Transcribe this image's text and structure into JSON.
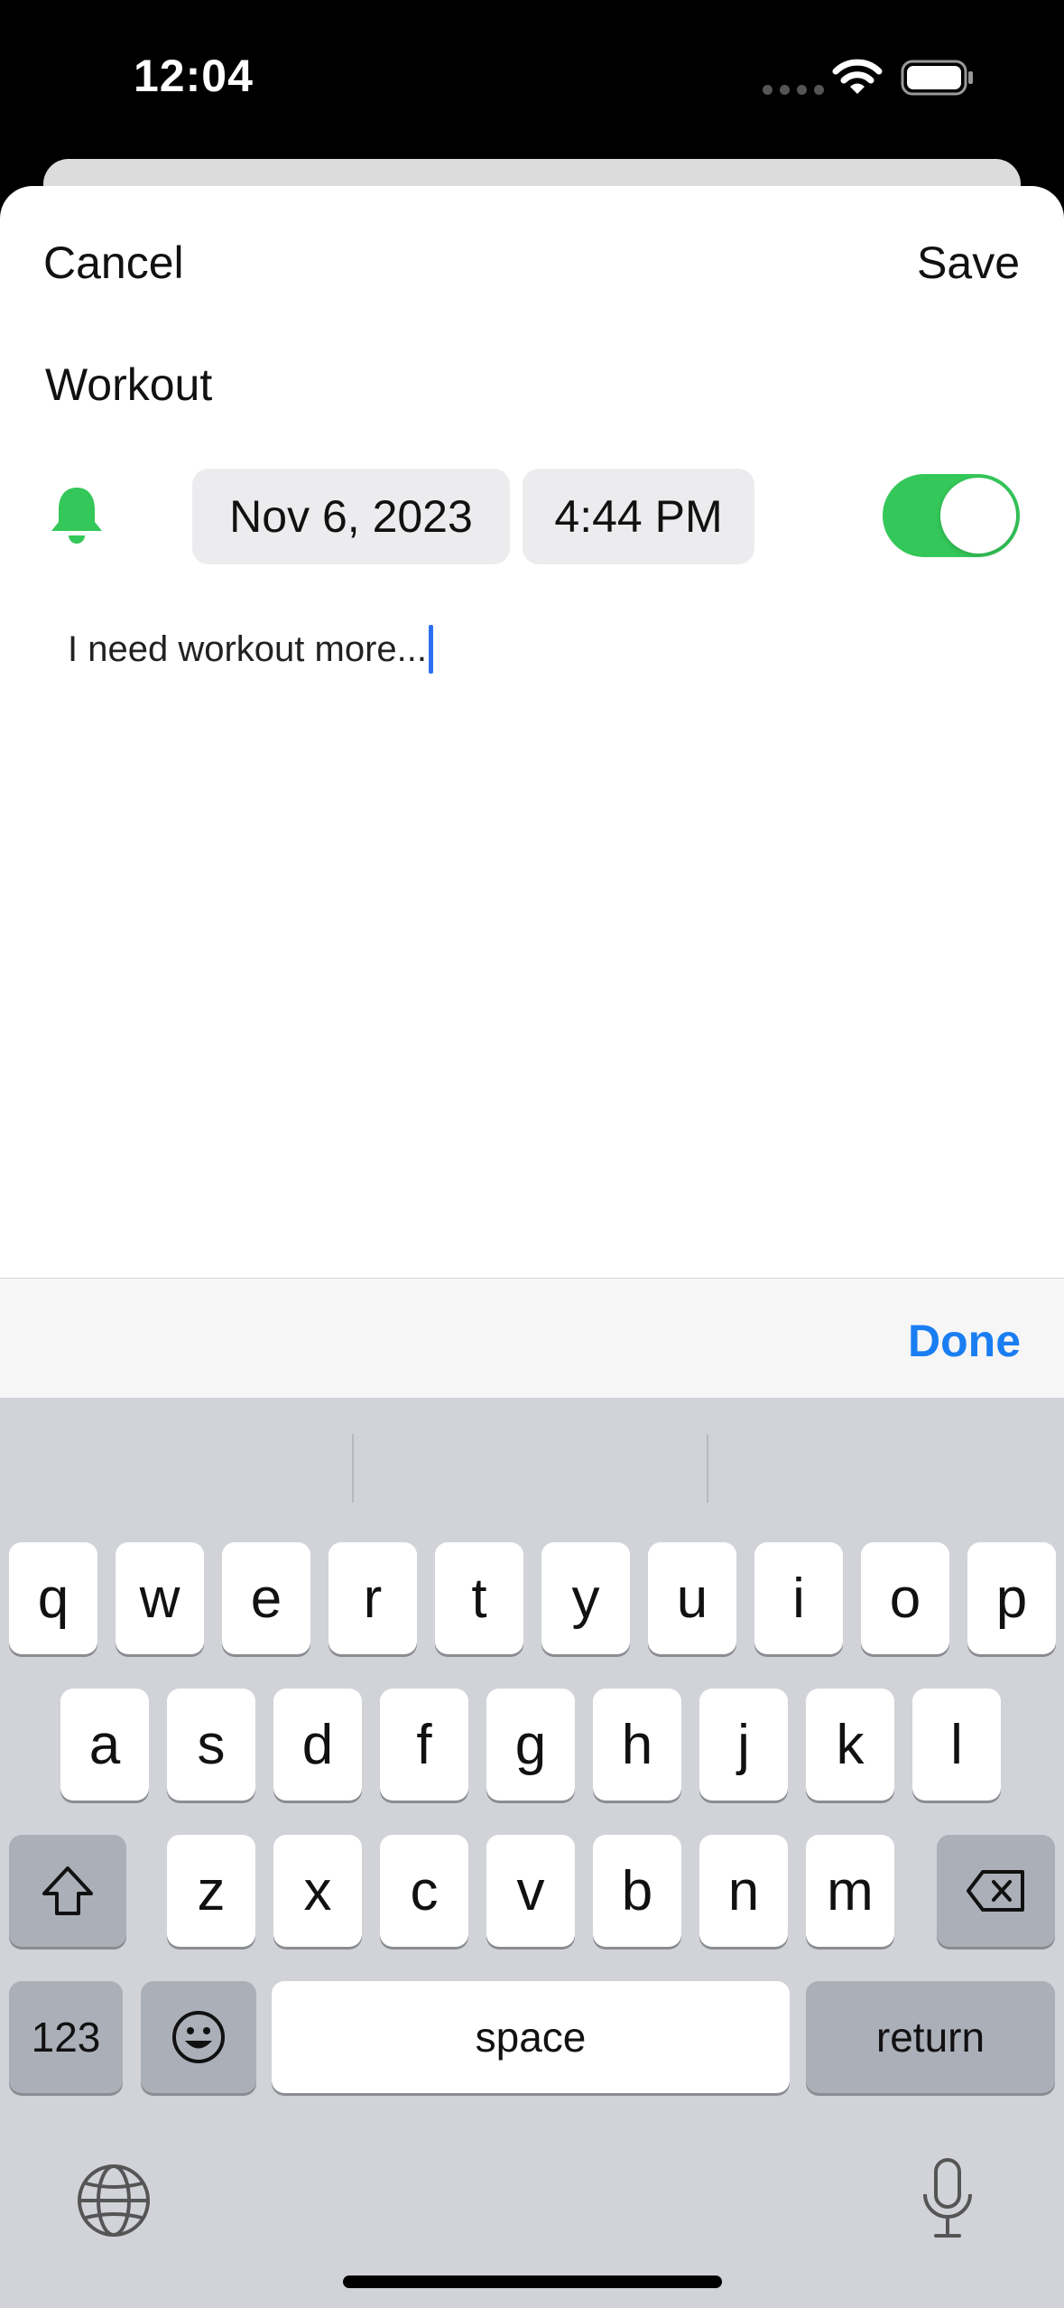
{
  "status_bar": {
    "time": "12:04"
  },
  "sheet": {
    "cancel_label": "Cancel",
    "save_label": "Save",
    "title": "Workout",
    "date": "Nov 6, 2023",
    "time": "4:44 PM",
    "reminder_enabled": true,
    "note_text": "I need workout more..."
  },
  "accessory": {
    "done_label": "Done"
  },
  "keyboard": {
    "row1": [
      "q",
      "w",
      "e",
      "r",
      "t",
      "y",
      "u",
      "i",
      "o",
      "p"
    ],
    "row2": [
      "a",
      "s",
      "d",
      "f",
      "g",
      "h",
      "j",
      "k",
      "l"
    ],
    "row3": [
      "z",
      "x",
      "c",
      "v",
      "b",
      "n",
      "m"
    ],
    "numbers_label": "123",
    "space_label": "space",
    "return_label": "return"
  },
  "colors": {
    "accent_green": "#34c759",
    "link_blue": "#1a7df2",
    "caret_blue": "#2c6ff2"
  },
  "icons": [
    "wifi-icon",
    "battery-icon",
    "bell-icon",
    "shift-icon",
    "delete-icon",
    "emoji-icon",
    "globe-icon",
    "mic-icon"
  ]
}
